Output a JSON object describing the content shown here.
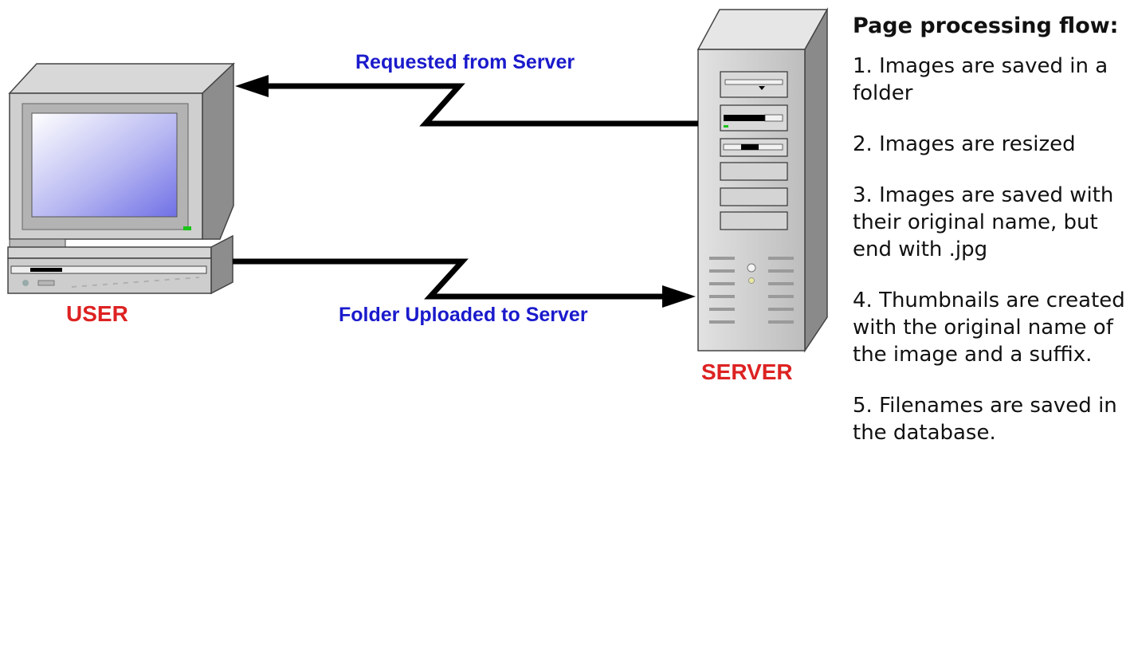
{
  "colors": {
    "arrow_label": "#1a1acc",
    "device_label": "#dd2222",
    "arrow": "#000000",
    "chassis": "#c9c9c9",
    "screen": "#8a8aee"
  },
  "arrows": {
    "requested_label": "Requested from Server",
    "uploaded_label": "Folder Uploaded to Server"
  },
  "devices": {
    "user_label": "USER",
    "server_label": "SERVER"
  },
  "notes": {
    "title": "Page processing flow:",
    "items": [
      "1. Images are saved in a folder",
      "2. Images are resized",
      "3. Images are saved with their original name, but end with .jpg",
      "4. Thumbnails are created with the original name of the image and a suffix.",
      "5. Filenames are saved in the database."
    ]
  }
}
